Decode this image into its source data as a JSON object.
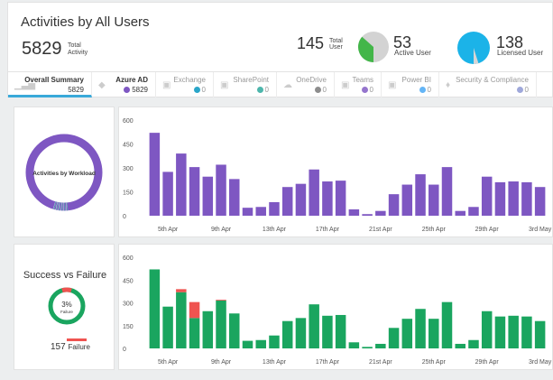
{
  "header": {
    "title": "Activities by All Users",
    "total_activity": {
      "value": "5829",
      "label_line1": "Total",
      "label_line2": "Activity"
    },
    "total_user": {
      "value": "145",
      "label_line1": "Total",
      "label_line2": "User"
    },
    "active_user": {
      "value": "53",
      "label": "Active User"
    },
    "licensed_user": {
      "value": "138",
      "label": "Licensed User"
    }
  },
  "tabs": [
    {
      "name": "Overall Summary",
      "count": "5829",
      "icon": "bar-chart-icon",
      "color": ""
    },
    {
      "name": "Azure AD",
      "count": "5829",
      "icon": "diamond-icon",
      "color": "#7e57c2"
    },
    {
      "name": "Exchange",
      "count": "0",
      "icon": "exchange-icon",
      "color": "#2aa6c9"
    },
    {
      "name": "SharePoint",
      "count": "0",
      "icon": "sharepoint-icon",
      "color": "#4db6ac"
    },
    {
      "name": "OneDrive",
      "count": "0",
      "icon": "cloud-icon",
      "color": "#8d8d8d"
    },
    {
      "name": "Teams",
      "count": "0",
      "icon": "teams-icon",
      "color": "#9575cd"
    },
    {
      "name": "Power BI",
      "count": "0",
      "icon": "powerbi-icon",
      "color": "#64b5f6"
    },
    {
      "name": "Security & Compliance",
      "count": "0",
      "icon": "shield-icon",
      "color": "#9fa8da"
    }
  ],
  "workload": {
    "center_label": "Activities by Workload"
  },
  "success_failure": {
    "title": "Success vs Failure",
    "percent": "3%",
    "percent_label": "Failure",
    "failure_count": "157",
    "failure_label": "Failure"
  },
  "colors": {
    "purple": "#7e57c2",
    "green": "#1aa55f",
    "red": "#ef5350",
    "active_green": "#43b649",
    "licensed_blue": "#1bb3e8",
    "tab_accent": "#39a9d9"
  },
  "chart_data": [
    {
      "type": "bar",
      "x_tick_labels": [
        "5th Apr",
        "9th Apr",
        "13th Apr",
        "17th Apr",
        "21st Apr",
        "25th Apr",
        "29th Apr",
        "3rd May"
      ],
      "ylim": [
        0,
        600
      ],
      "y_ticks": [
        "0",
        "150",
        "300",
        "450",
        "600"
      ],
      "series": [
        {
          "values": [
            520,
            275,
            390,
            305,
            245,
            320,
            230,
            50,
            55,
            85,
            180,
            200,
            290,
            215,
            220,
            40,
            10,
            30,
            135,
            195,
            260,
            195,
            305,
            30,
            55,
            245,
            210,
            215,
            210,
            180
          ]
        }
      ]
    },
    {
      "type": "bar",
      "x_tick_labels": [
        "5th Apr",
        "9th Apr",
        "13th Apr",
        "17th Apr",
        "21st Apr",
        "25th Apr",
        "29th Apr",
        "3rd May"
      ],
      "ylim": [
        0,
        600
      ],
      "y_ticks": [
        "0",
        "150",
        "300",
        "450",
        "600"
      ],
      "series": [
        {
          "name": "Success",
          "values": [
            520,
            275,
            370,
            200,
            245,
            315,
            230,
            50,
            55,
            85,
            180,
            200,
            290,
            215,
            220,
            40,
            10,
            30,
            135,
            195,
            260,
            195,
            305,
            30,
            55,
            245,
            210,
            215,
            210,
            180
          ]
        },
        {
          "name": "Failure",
          "values": [
            0,
            0,
            20,
            105,
            0,
            5,
            0,
            0,
            0,
            0,
            0,
            0,
            0,
            0,
            0,
            0,
            0,
            0,
            0,
            0,
            0,
            0,
            0,
            0,
            0,
            0,
            0,
            0,
            0,
            0
          ]
        }
      ]
    }
  ]
}
